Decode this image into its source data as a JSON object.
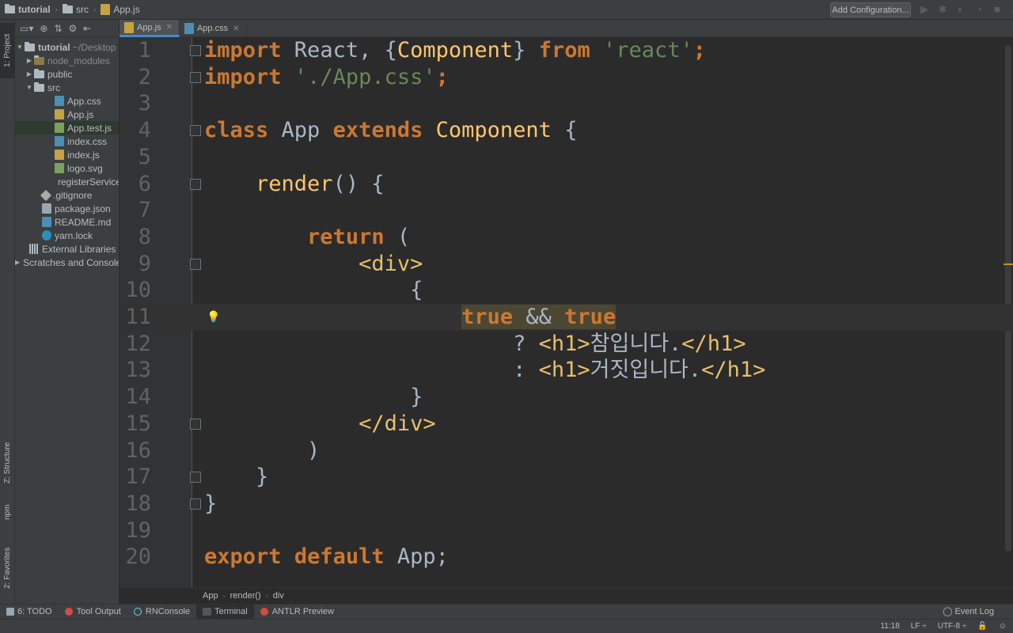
{
  "breadcrumb": {
    "project": "tutorial",
    "folder": "src",
    "file": "App.js"
  },
  "toolbar": {
    "add_configuration": "Add Configuration..."
  },
  "left_strip": {
    "project_tab": "1: Project",
    "structure_tab": "Z: Structure",
    "npm_tab": "npm",
    "favorites_tab": "2: Favorites"
  },
  "tree": {
    "root": "tutorial",
    "root_path": "~/Desktop",
    "node_modules": "node_modules",
    "public": "public",
    "src": "src",
    "files": [
      "App.css",
      "App.js",
      "App.test.js",
      "index.css",
      "index.js",
      "logo.svg",
      "registerServiceWorker.js"
    ],
    "gitignore": ".gitignore",
    "package": "package.json",
    "readme": "README.md",
    "yarn": "yarn.lock",
    "external": "External Libraries",
    "scratches": "Scratches and Consoles"
  },
  "tabs": [
    {
      "label": "App.js"
    },
    {
      "label": "App.css"
    }
  ],
  "code_lines": [
    {
      "n": "1"
    },
    {
      "n": "2"
    },
    {
      "n": "3"
    },
    {
      "n": "4"
    },
    {
      "n": "5"
    },
    {
      "n": "6"
    },
    {
      "n": "7"
    },
    {
      "n": "8"
    },
    {
      "n": "9"
    },
    {
      "n": "10"
    },
    {
      "n": "11"
    },
    {
      "n": "12"
    },
    {
      "n": "13"
    },
    {
      "n": "14"
    },
    {
      "n": "15"
    },
    {
      "n": "16"
    },
    {
      "n": "17"
    },
    {
      "n": "18"
    },
    {
      "n": "19"
    },
    {
      "n": "20"
    }
  ],
  "code": {
    "l1": {
      "a": "import",
      "b": " React, {",
      "c": "Component",
      "d": "} ",
      "e": "from",
      "f": " ",
      "g": "'react'",
      "h": ";"
    },
    "l2": {
      "a": "import",
      "b": " ",
      "c": "'./App.css'",
      "d": ";"
    },
    "l4": {
      "a": "class",
      "b": " App ",
      "c": "extends",
      "d": " ",
      "e": "Component",
      "f": " {"
    },
    "l6": {
      "a": "    ",
      "b": "render",
      "c": "() {"
    },
    "l8": {
      "a": "        ",
      "b": "return",
      "c": " ("
    },
    "l9": {
      "a": "            ",
      "b": "<div>"
    },
    "l10": {
      "a": "                {"
    },
    "l11": {
      "a": "                    ",
      "b": "true",
      "c": " && ",
      "d": "true"
    },
    "l12": {
      "a": "                        ? ",
      "b": "<h1>",
      "c": "참입니다.",
      "d": "</h1>"
    },
    "l13": {
      "a": "                        : ",
      "b": "<h1>",
      "c": "거짓입니다.",
      "d": "</h1>"
    },
    "l14": {
      "a": "                }"
    },
    "l15": {
      "a": "            ",
      "b": "</div>"
    },
    "l16": {
      "a": "        )"
    },
    "l17": {
      "a": "    }"
    },
    "l18": {
      "a": "}"
    },
    "l20": {
      "a": "export",
      "b": " ",
      "c": "default",
      "d": " App;"
    }
  },
  "nav": {
    "a": "App",
    "b": "render()",
    "c": "div"
  },
  "bottom": {
    "todo": "6: TODO",
    "tool_output": "Tool Output",
    "rnconsole": "RNConsole",
    "terminal": "Terminal",
    "antlr": "ANTLR Preview",
    "event_log": "Event Log"
  },
  "status": {
    "position": "11:18",
    "line_sep": "LF ÷",
    "encoding": "UTF-8 ÷"
  }
}
